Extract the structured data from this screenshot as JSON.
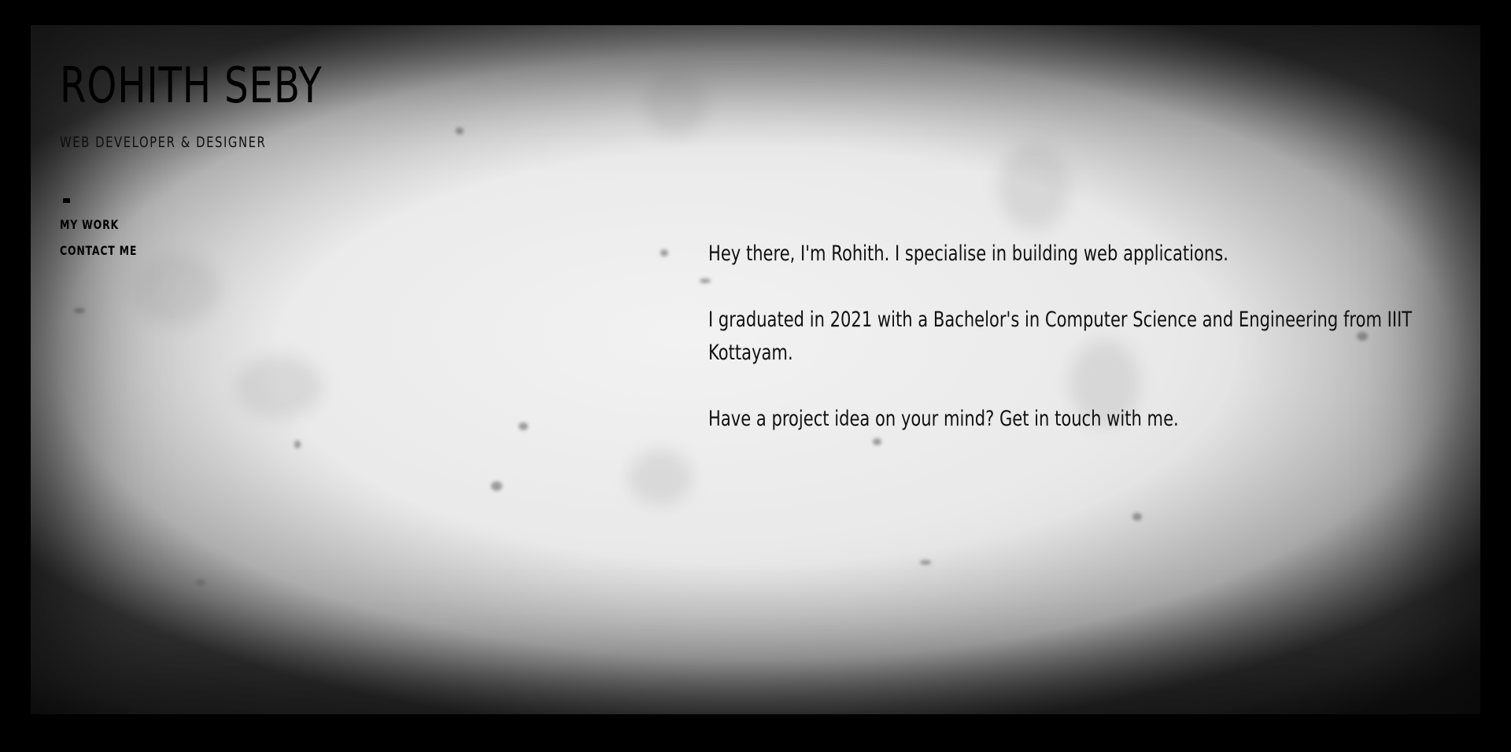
{
  "site": {
    "title": "ROHITH SEBY",
    "subtitle": "WEB DEVELOPER & DESIGNER"
  },
  "nav": {
    "items": [
      {
        "label": "MY WORK"
      },
      {
        "label": "CONTACT ME"
      }
    ]
  },
  "intro": {
    "paragraphs": [
      "Hey there, I'm Rohith. I specialise in building web applications.",
      "I graduated in 2021 with a Bachelor's in Computer Science and Engineering from IIIT Kottayam.",
      "Have a project idea on your mind? Get in touch with me."
    ]
  },
  "colors": {
    "page_background": "#000000",
    "text": "#000000",
    "panel": "#ececec"
  }
}
